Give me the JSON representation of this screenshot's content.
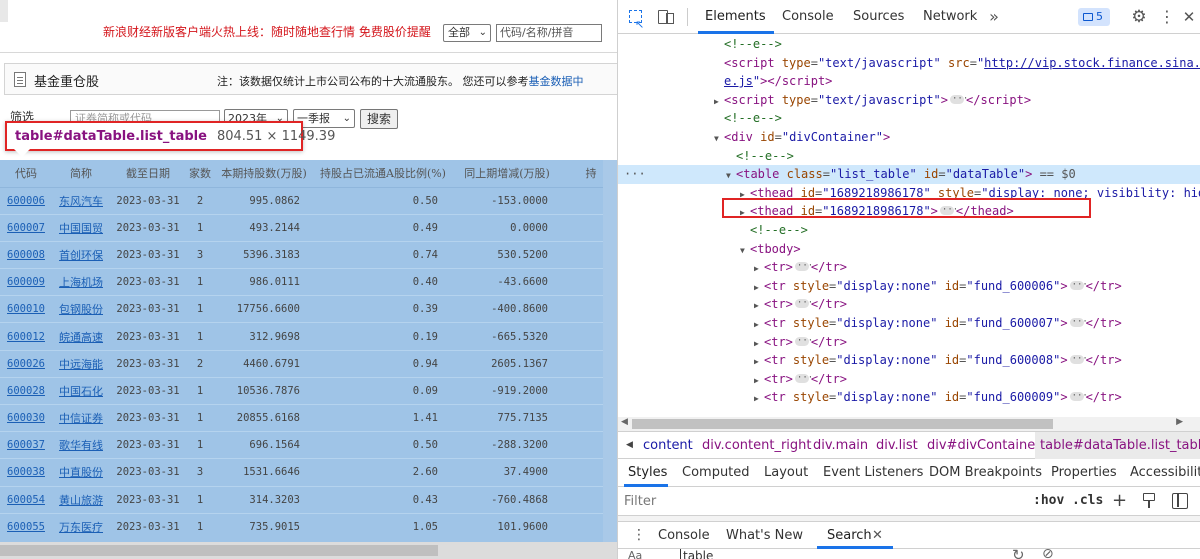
{
  "page": {
    "promo": "新浪财经新版客户端火热上线：随时随地查行情 免费股价提醒",
    "market_select": "全部",
    "search_placeholder": "代码/名称/拼音",
    "fund_title": "基金重仓股",
    "fund_note": "注：该数据仅统计上市公司公布的十大流通股东。 您还可以参考",
    "fund_note_link": "基金数据中",
    "filter_label": "筛选",
    "filter_placeholder": "证券简称或代码",
    "year": "2023年",
    "quarter": "一季报",
    "query_button": "搜索"
  },
  "tooltip": {
    "selector": "table#dataTable.list_table",
    "dims": "804.51 × 1149.39"
  },
  "table": {
    "headers": [
      "代码",
      "简称",
      "截至日期",
      "家数",
      "本期持股数(万股)",
      "持股占已流通A股比例(%)",
      "同上期增减(万股)",
      "持"
    ],
    "rows": [
      {
        "code": "600006",
        "name": "东风汽车",
        "date": "2023-03-31",
        "count": "2",
        "shares": "995.0862",
        "ratio": "0.50",
        "change": "-153.0000"
      },
      {
        "code": "600007",
        "name": "中国国贸",
        "date": "2023-03-31",
        "count": "1",
        "shares": "493.2144",
        "ratio": "0.49",
        "change": "0.0000"
      },
      {
        "code": "600008",
        "name": "首创环保",
        "date": "2023-03-31",
        "count": "3",
        "shares": "5396.3183",
        "ratio": "0.74",
        "change": "530.5200"
      },
      {
        "code": "600009",
        "name": "上海机场",
        "date": "2023-03-31",
        "count": "1",
        "shares": "986.0111",
        "ratio": "0.40",
        "change": "-43.6600"
      },
      {
        "code": "600010",
        "name": "包钢股份",
        "date": "2023-03-31",
        "count": "1",
        "shares": "17756.6600",
        "ratio": "0.39",
        "change": "-400.8600"
      },
      {
        "code": "600012",
        "name": "皖通高速",
        "date": "2023-03-31",
        "count": "1",
        "shares": "312.9698",
        "ratio": "0.19",
        "change": "-665.5320"
      },
      {
        "code": "600026",
        "name": "中远海能",
        "date": "2023-03-31",
        "count": "2",
        "shares": "4460.6791",
        "ratio": "0.94",
        "change": "2605.1367"
      },
      {
        "code": "600028",
        "name": "中国石化",
        "date": "2023-03-31",
        "count": "1",
        "shares": "10536.7876",
        "ratio": "0.09",
        "change": "-919.2000"
      },
      {
        "code": "600030",
        "name": "中信证券",
        "date": "2023-03-31",
        "count": "1",
        "shares": "20855.6168",
        "ratio": "1.41",
        "change": "775.7135"
      },
      {
        "code": "600037",
        "name": "歌华有线",
        "date": "2023-03-31",
        "count": "1",
        "shares": "696.1564",
        "ratio": "0.50",
        "change": "-288.3200"
      },
      {
        "code": "600038",
        "name": "中直股份",
        "date": "2023-03-31",
        "count": "3",
        "shares": "1531.6646",
        "ratio": "2.60",
        "change": "37.4900"
      },
      {
        "code": "600054",
        "name": "黄山旅游",
        "date": "2023-03-31",
        "count": "1",
        "shares": "314.3203",
        "ratio": "0.43",
        "change": "-760.4868"
      },
      {
        "code": "600055",
        "name": "万东医疗",
        "date": "2023-03-31",
        "count": "1",
        "shares": "735.9015",
        "ratio": "1.05",
        "change": "101.9600"
      }
    ]
  },
  "devtools": {
    "tabs": {
      "elements": "Elements",
      "console": "Console",
      "sources": "Sources",
      "network": "Network"
    },
    "more_tabs": "»",
    "issues_count": "5",
    "dom": {
      "comment": "<!--e-->",
      "script1_src": "http://vip.stock.finance.sina.c",
      "script1_src_cont": "e.js",
      "div_id": "divContainer",
      "table_class": "list_table",
      "table_id": "dataTable",
      "sel_marker": "== $0",
      "thead1_id": "1689218986178",
      "thead1_style": "display: none; visibility: hid",
      "thead2_id": "1689218986178",
      "tr_style": "display:none",
      "tr_ids": [
        "fund_600006",
        "fund_600007",
        "fund_600008",
        "fund_600009"
      ]
    },
    "breadcrumbs": [
      "content",
      "div.content_right",
      "div.main",
      "div.list",
      "div#divContainer",
      "table#dataTable.list_table"
    ],
    "style_tabs": [
      "Styles",
      "Computed",
      "Layout",
      "Event Listeners",
      "DOM Breakpoints",
      "Properties",
      "Accessibility"
    ],
    "filter_placeholder": "Filter",
    "hov": ":hov",
    "cls": ".cls",
    "drawer_tabs": [
      "Console",
      "What's New",
      "Search"
    ],
    "search_input": "table",
    "aa": "Aa"
  }
}
